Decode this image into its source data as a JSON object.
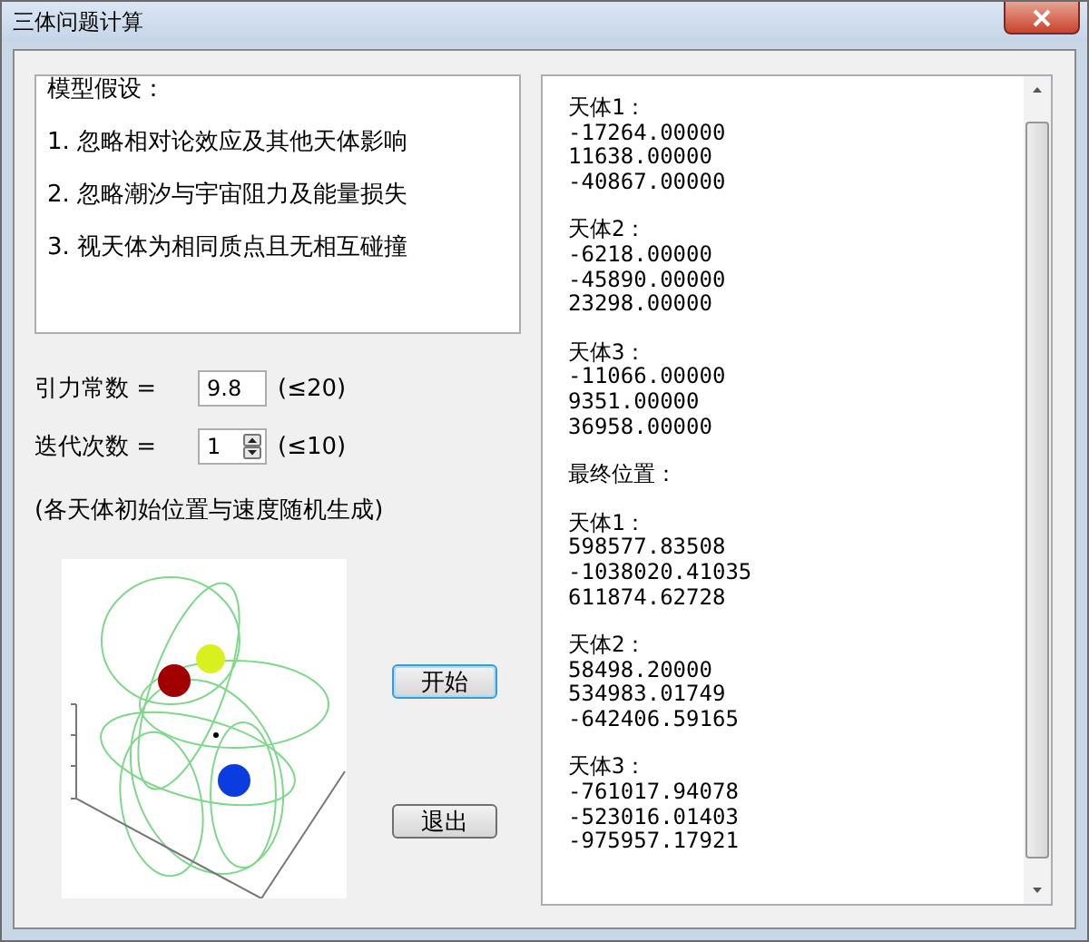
{
  "window": {
    "title": "三体问题计算"
  },
  "assumptions": {
    "heading": "模型假设：",
    "items": [
      "1. 忽略相对论效应及其他天体影响",
      "2. 忽略潮汐与宇宙阻力及能量损失",
      "3. 视天体为相同质点且无相互碰撞"
    ]
  },
  "params": [
    {
      "kind": "text",
      "label": "引力常数 =",
      "value": "9.8",
      "limit": "(≤20)"
    },
    {
      "kind": "spinner",
      "label": "迭代次数 =",
      "value": "1",
      "limit": "(≤10)"
    }
  ],
  "note": "(各天体初始位置与速度随机生成)",
  "buttons": [
    {
      "label": "开始",
      "focused": true
    },
    {
      "label": "退出",
      "focused": false
    }
  ],
  "output": {
    "initial": [
      {
        "title": "天体1：",
        "values": [
          "-17264.00000",
          "11638.00000",
          "-40867.00000"
        ]
      },
      {
        "title": "天体2：",
        "values": [
          "-6218.00000",
          "-45890.00000",
          "23298.00000"
        ]
      },
      {
        "title": "天体3：",
        "values": [
          "-11066.00000",
          "9351.00000",
          "36958.00000"
        ]
      }
    ],
    "final_heading": "最终位置：",
    "final": [
      {
        "title": "天体1：",
        "values": [
          "598577.83508",
          "-1038020.41035",
          "611874.62728"
        ]
      },
      {
        "title": "天体2：",
        "values": [
          "58498.20000",
          "534983.01749",
          "-642406.59165"
        ]
      },
      {
        "title": "天体3：",
        "values": [
          "-761017.94078",
          "-523016.01403",
          "-975957.17921"
        ]
      }
    ]
  }
}
